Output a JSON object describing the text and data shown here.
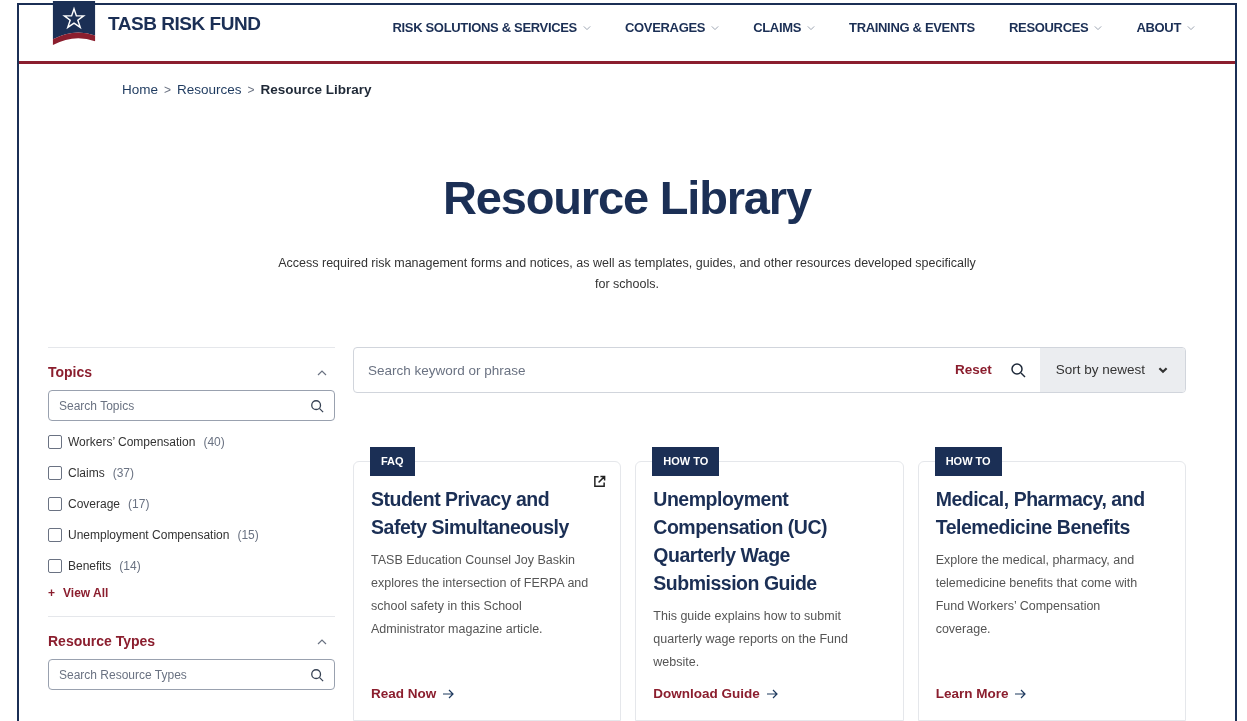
{
  "header": {
    "logo_text": "TASB RISK FUND",
    "nav": [
      {
        "label": "RISK SOLUTIONS & SERVICES",
        "dropdown": true
      },
      {
        "label": "COVERAGES",
        "dropdown": true
      },
      {
        "label": "CLAIMS",
        "dropdown": true
      },
      {
        "label": "TRAINING & EVENTS",
        "dropdown": false
      },
      {
        "label": "RESOURCES",
        "dropdown": true
      },
      {
        "label": "ABOUT",
        "dropdown": true
      }
    ]
  },
  "breadcrumb": [
    {
      "label": "Home",
      "current": false
    },
    {
      "label": "Resources",
      "current": false
    },
    {
      "label": "Resource Library",
      "current": true
    }
  ],
  "breadcrumb_separator": ">",
  "page_title": "Resource Library",
  "intro": "Access required risk management forms and notices, as well as templates, guides, and other resources developed specifically for schools.",
  "filters": [
    {
      "title": "Topics",
      "expanded": true,
      "search_placeholder": "Search Topics",
      "options": [
        {
          "label": "Workers’ Compensation",
          "count": "(40)",
          "checked": false
        },
        {
          "label": "Claims",
          "count": "(37)",
          "checked": false
        },
        {
          "label": "Coverage",
          "count": "(17)",
          "checked": false
        },
        {
          "label": "Unemployment Compensation",
          "count": "(15)",
          "checked": false
        },
        {
          "label": "Benefits",
          "count": "(14)",
          "checked": false
        }
      ],
      "view_all_icon": "+",
      "view_all": "View All"
    },
    {
      "title": "Resource Types",
      "expanded": true,
      "search_placeholder": "Search Resource Types"
    }
  ],
  "search": {
    "placeholder": "Search keyword or phrase",
    "reset": "Reset",
    "sort": "Sort by newest"
  },
  "cards": [
    {
      "tag": "FAQ",
      "external": true,
      "title": "Student Privacy and Safety Simultaneously",
      "description": "TASB Education Counsel Joy Baskin explores the intersection of FERPA and school safety in this School Administrator magazine article.",
      "link": "Read Now"
    },
    {
      "tag": "HOW TO",
      "external": false,
      "title": "Unemployment Compensation (UC) Quarterly Wage Submission Guide",
      "description": "This guide explains how to submit quarterly wage reports on the Fund website.",
      "link": "Download Guide"
    },
    {
      "tag": "HOW TO",
      "external": false,
      "title": "Medical, Pharmacy, and Telemedicine Benefits",
      "description": "Explore the medical, pharmacy, and telemedicine benefits that come with Fund Workers’ Compensation coverage.",
      "link": "Learn More"
    }
  ]
}
